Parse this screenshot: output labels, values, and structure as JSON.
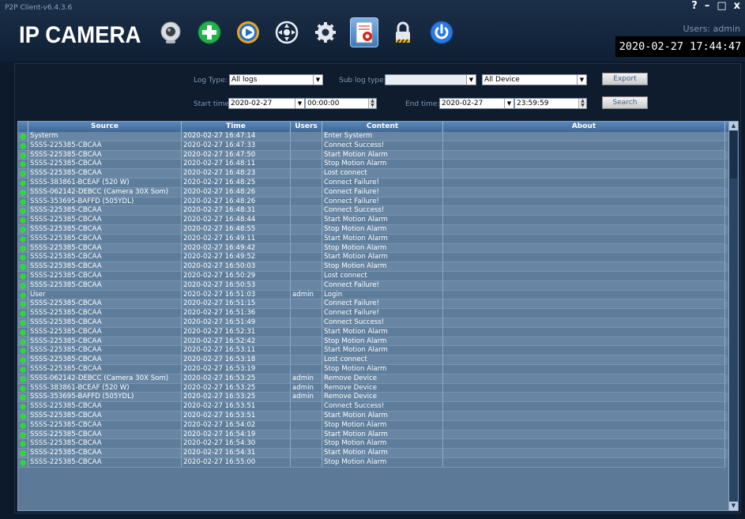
{
  "window": {
    "title": "P2P Client-v6.4.3.6",
    "controls": [
      "?",
      "–",
      "□",
      "x"
    ]
  },
  "app": {
    "logo": "IP CAMERA"
  },
  "toolbar": [
    {
      "name": "camera-icon"
    },
    {
      "name": "add-icon"
    },
    {
      "name": "playback-icon"
    },
    {
      "name": "ptz-icon"
    },
    {
      "name": "settings-icon"
    },
    {
      "name": "log-icon",
      "active": true
    },
    {
      "name": "lock-icon"
    },
    {
      "name": "power-icon"
    }
  ],
  "status": {
    "users": "Users: admin",
    "clock": "2020-02-27  17:44:47"
  },
  "filters": {
    "log_type_label": "Log Type:",
    "log_type_value": "All logs",
    "sub_log_type_label": "Sub log type:",
    "sub_log_type_value": "",
    "device_value": "All Device",
    "export_label": "Export",
    "start_time_label": "Start time:",
    "start_date": "2020-02-27",
    "start_time": "00:00:00",
    "end_time_label": "End time:",
    "end_date": "2020-02-27",
    "end_time": "23:59:59",
    "search_label": "Search"
  },
  "table": {
    "columns": [
      "Source",
      "Time",
      "Users",
      "Content",
      "About"
    ],
    "rows": [
      [
        "Systerm",
        "2020-02-27 16:47:14",
        "",
        "Enter Systerm"
      ],
      [
        "SSSS-225385-CBCAA",
        "2020-02-27 16:47:33",
        "",
        "Connect Success!"
      ],
      [
        "SSSS-225385-CBCAA",
        "2020-02-27 16:47:50",
        "",
        "Start Motion Alarm"
      ],
      [
        "SSSS-225385-CBCAA",
        "2020-02-27 16:48:11",
        "",
        "Stop Motion Alarm"
      ],
      [
        "SSSS-225385-CBCAA",
        "2020-02-27 16:48:23",
        "",
        "Lost connect"
      ],
      [
        "SSSS-383861-BCEAF (520 W)",
        "2020-02-27 16:48:25",
        "",
        "Connect Failure!"
      ],
      [
        "SSSS-062142-DEBCC (Camera 30X Som)",
        "2020-02-27 16:48:26",
        "",
        "Connect Failure!"
      ],
      [
        "SSSS-353695-BAFFD (505YDL)",
        "2020-02-27 16:48:26",
        "",
        "Connect Failure!"
      ],
      [
        "SSSS-225385-CBCAA",
        "2020-02-27 16:48:31",
        "",
        "Connect Success!"
      ],
      [
        "SSSS-225385-CBCAA",
        "2020-02-27 16:48:44",
        "",
        "Start Motion Alarm"
      ],
      [
        "SSSS-225385-CBCAA",
        "2020-02-27 16:48:55",
        "",
        "Stop Motion Alarm"
      ],
      [
        "SSSS-225385-CBCAA",
        "2020-02-27 16:49:11",
        "",
        "Start Motion Alarm"
      ],
      [
        "SSSS-225385-CBCAA",
        "2020-02-27 16:49:42",
        "",
        "Stop Motion Alarm"
      ],
      [
        "SSSS-225385-CBCAA",
        "2020-02-27 16:49:52",
        "",
        "Start Motion Alarm"
      ],
      [
        "SSSS-225385-CBCAA",
        "2020-02-27 16:50:03",
        "",
        "Stop Motion Alarm"
      ],
      [
        "SSSS-225385-CBCAA",
        "2020-02-27 16:50:29",
        "",
        "Lost connect"
      ],
      [
        "SSSS-225385-CBCAA",
        "2020-02-27 16:50:53",
        "",
        "Connect Failure!"
      ],
      [
        "User",
        "2020-02-27 16:51:03",
        "admin",
        "Login"
      ],
      [
        "SSSS-225385-CBCAA",
        "2020-02-27 16:51:15",
        "",
        "Connect Failure!"
      ],
      [
        "SSSS-225385-CBCAA",
        "2020-02-27 16:51:36",
        "",
        "Connect Failure!"
      ],
      [
        "SSSS-225385-CBCAA",
        "2020-02-27 16:51:49",
        "",
        "Connect Success!"
      ],
      [
        "SSSS-225385-CBCAA",
        "2020-02-27 16:52:31",
        "",
        "Start Motion Alarm"
      ],
      [
        "SSSS-225385-CBCAA",
        "2020-02-27 16:52:42",
        "",
        "Stop Motion Alarm"
      ],
      [
        "SSSS-225385-CBCAA",
        "2020-02-27 16:53:11",
        "",
        "Start Motion Alarm"
      ],
      [
        "SSSS-225385-CBCAA",
        "2020-02-27 16:53:18",
        "",
        "Lost connect"
      ],
      [
        "SSSS-225385-CBCAA",
        "2020-02-27 16:53:19",
        "",
        "Stop Motion Alarm"
      ],
      [
        "SSSS-062142-DEBCC (Camera 30X Som)",
        "2020-02-27 16:53:25",
        "admin",
        "Remove Device"
      ],
      [
        "SSSS-383861-BCEAF (520 W)",
        "2020-02-27 16:53:25",
        "admin",
        "Remove Device"
      ],
      [
        "SSSS-353695-BAFFD (505YDL)",
        "2020-02-27 16:53:25",
        "admin",
        "Remove Device"
      ],
      [
        "SSSS-225385-CBCAA",
        "2020-02-27 16:53:51",
        "",
        "Connect Success!"
      ],
      [
        "SSSS-225385-CBCAA",
        "2020-02-27 16:53:51",
        "",
        "Start Motion Alarm"
      ],
      [
        "SSSS-225385-CBCAA",
        "2020-02-27 16:54:02",
        "",
        "Stop Motion Alarm"
      ],
      [
        "SSSS-225385-CBCAA",
        "2020-02-27 16:54:19",
        "",
        "Start Motion Alarm"
      ],
      [
        "SSSS-225385-CBCAA",
        "2020-02-27 16:54:30",
        "",
        "Stop Motion Alarm"
      ],
      [
        "SSSS-225385-CBCAA",
        "2020-02-27 16:54:31",
        "",
        "Start Motion Alarm"
      ],
      [
        "SSSS-225385-CBCAA",
        "2020-02-27 16:55:00",
        "",
        "Stop Motion Alarm"
      ]
    ]
  },
  "colors": {
    "online_dot": "#19e619",
    "accent": "#3e7ab8"
  }
}
